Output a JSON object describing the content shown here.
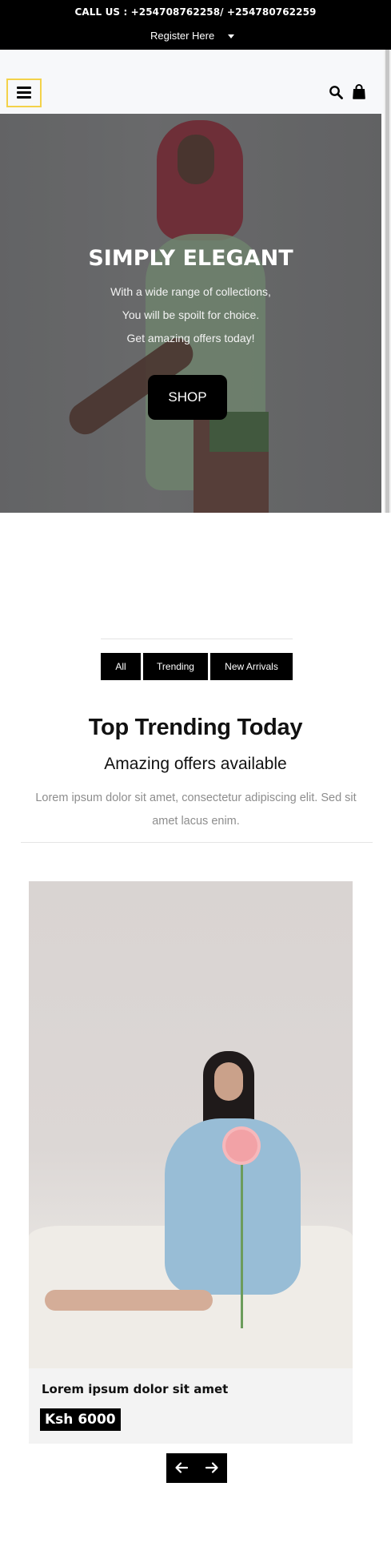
{
  "topbar": {
    "call_text": "CALL US : +254708762258/ +254780762259",
    "register_label": "Register Here"
  },
  "nav": {
    "menu_icon": "hamburger-icon",
    "search_icon": "search-icon",
    "cart_icon": "shopping-bag-icon"
  },
  "hero": {
    "title": "SIMPLY ELEGANT",
    "line1": "With a wide range of collections,",
    "line2": "You will be spoilt for choice.",
    "line3": "Get amazing offers today!",
    "shop_label": "SHOP"
  },
  "filters": {
    "all": "All",
    "trending": "Trending",
    "new_arrivals": "New Arrivals"
  },
  "section": {
    "title": "Top Trending Today",
    "subtitle": "Amazing offers available",
    "description": "Lorem ipsum dolor sit amet, consectetur adipiscing elit. Sed sit amet lacus enim."
  },
  "product": {
    "name": "Lorem ipsum dolor sit amet",
    "price": "Ksh 6000"
  },
  "carousel": {
    "prev_icon": "arrow-left-icon",
    "next_icon": "arrow-right-icon"
  },
  "colors": {
    "topbar_bg": "#000000",
    "menu_border": "#f3d24a",
    "button_bg": "#000000",
    "muted_text": "#8d8d8d"
  }
}
